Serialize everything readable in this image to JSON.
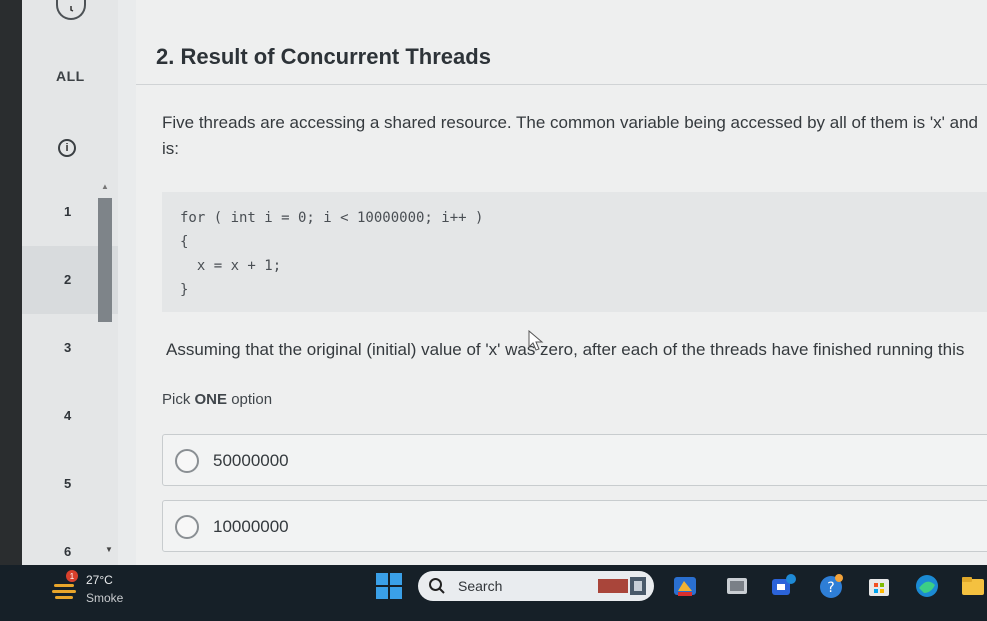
{
  "sidebar": {
    "all_label": "ALL",
    "info_glyph": "i",
    "questions": [
      "1",
      "2",
      "3",
      "4",
      "5",
      "6"
    ],
    "active_index": 1
  },
  "question": {
    "title": "2. Result of Concurrent Threads",
    "description_line1": "Five threads are accessing a shared resource. The common variable being accessed by all of them is 'x' and",
    "description_line2": "is:",
    "code": "for ( int i = 0; i < 10000000; i++ )\n{\n  x = x + 1;\n}",
    "assumption": "Assuming that the original (initial) value of 'x' was zero, after each of the threads have finished running this",
    "pick_prefix": "Pick ",
    "pick_bold": "ONE",
    "pick_suffix": " option",
    "options": [
      "50000000",
      "10000000"
    ]
  },
  "taskbar": {
    "weather_badge": "1",
    "temperature": "27°C",
    "condition": "Smoke",
    "search_label": "Search",
    "icons": [
      "start-icon",
      "search-icon",
      "widgets-icon",
      "copilot-icon",
      "file-explorer-icon",
      "teams-icon",
      "help-icon",
      "store-icon",
      "edge-icon",
      "folder-icon"
    ]
  },
  "colors": {
    "screen_bg": "#eeefef",
    "sidebar_bg": "#e4e6e7",
    "taskbar_bg": "#162028",
    "accent_blue": "#1e8ad6"
  }
}
